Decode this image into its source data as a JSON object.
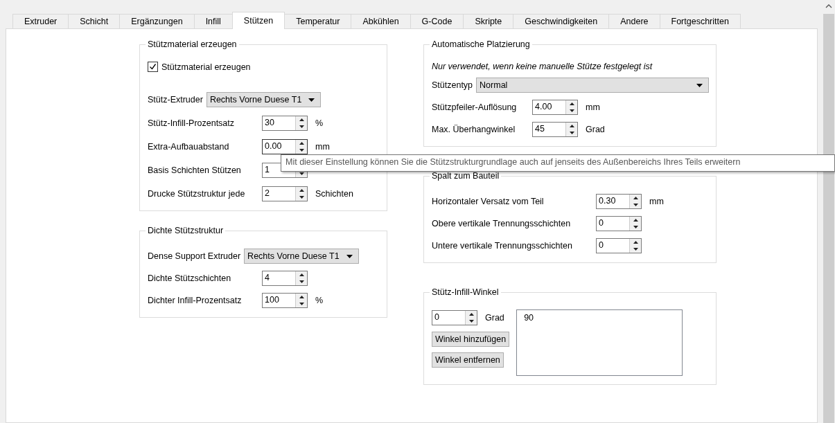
{
  "tabs": [
    {
      "label": "Extruder",
      "selected": false
    },
    {
      "label": "Schicht",
      "selected": false
    },
    {
      "label": "Ergänzungen",
      "selected": false
    },
    {
      "label": "Infill",
      "selected": false
    },
    {
      "label": "Stützen",
      "selected": true
    },
    {
      "label": "Temperatur",
      "selected": false
    },
    {
      "label": "Abkühlen",
      "selected": false
    },
    {
      "label": "G-Code",
      "selected": false
    },
    {
      "label": "Skripte",
      "selected": false
    },
    {
      "label": "Geschwindigkeiten",
      "selected": false
    },
    {
      "label": "Andere",
      "selected": false
    },
    {
      "label": "Fortgeschritten",
      "selected": false
    }
  ],
  "left_groups": [
    {
      "title": "Stützmaterial erzeugen",
      "rows": [
        {
          "kind": "checkbox",
          "label": "Stützmaterial erzeugen",
          "checked": true
        },
        {
          "kind": "dropdown",
          "label": "Stütz-Extruder",
          "value": "Rechts Vorne Duese T1"
        },
        {
          "kind": "spinner",
          "label": "Stütz-Infill-Prozentsatz",
          "value": "30",
          "unit": "%"
        },
        {
          "kind": "spinner",
          "label": "Extra-Aufbauabstand",
          "value": "0.00",
          "unit": "mm",
          "focused": true
        },
        {
          "kind": "spinner",
          "label": "Basis Schichten Stützen",
          "value": "1"
        },
        {
          "kind": "spinner",
          "label": "Drucke Stützstruktur jede",
          "value": "2",
          "unit": "Schichten"
        }
      ]
    },
    {
      "title": "Dichte Stützstruktur",
      "rows": [
        {
          "kind": "dropdown",
          "label": "Dense Support Extruder",
          "value": "Rechts Vorne Duese T1"
        },
        {
          "kind": "spinner",
          "label": "Dichte Stützschichten",
          "value": "4"
        },
        {
          "kind": "spinner",
          "label": "Dichter Infill-Prozentsatz",
          "value": "100",
          "unit": "%"
        }
      ]
    }
  ],
  "right_groups": [
    {
      "title": "Automatische Platzierung",
      "rows": [
        {
          "kind": "note",
          "label": "Nur verwendet, wenn keine manuelle Stütze festgelegt ist"
        },
        {
          "kind": "wide_dropdown",
          "label": "Stützentyp",
          "value": "Normal"
        },
        {
          "kind": "spinner",
          "label": "Stützpfeiler-Auflösung",
          "value": "4.00",
          "unit": "mm"
        },
        {
          "kind": "spinner",
          "label": "Max. Überhangwinkel",
          "value": "45",
          "unit": "Grad"
        }
      ]
    },
    {
      "title": "Spalt zum Bauteil",
      "rows": [
        {
          "kind": "spinner",
          "label": "Horizontaler Versatz vom Teil",
          "value": "0.30",
          "unit": "mm"
        },
        {
          "kind": "spinner",
          "label": "Obere vertikale Trennungsschichten",
          "value": "0"
        },
        {
          "kind": "spinner",
          "label": "Untere vertikale Trennungsschichten",
          "value": "0"
        }
      ]
    },
    {
      "title": "Stütz-Infill-Winkel",
      "rows": [
        {
          "kind": "angles",
          "value": "0",
          "unit": "Grad",
          "buttons": [
            "Winkel hinzufügen",
            "Winkel entfernen"
          ],
          "list": [
            "90"
          ]
        }
      ]
    }
  ],
  "tooltip": "Mit dieser Einstellung können Sie die Stützstrukturgrundlage auch auf jenseits des Außenbereichs Ihres Teils erweitern"
}
